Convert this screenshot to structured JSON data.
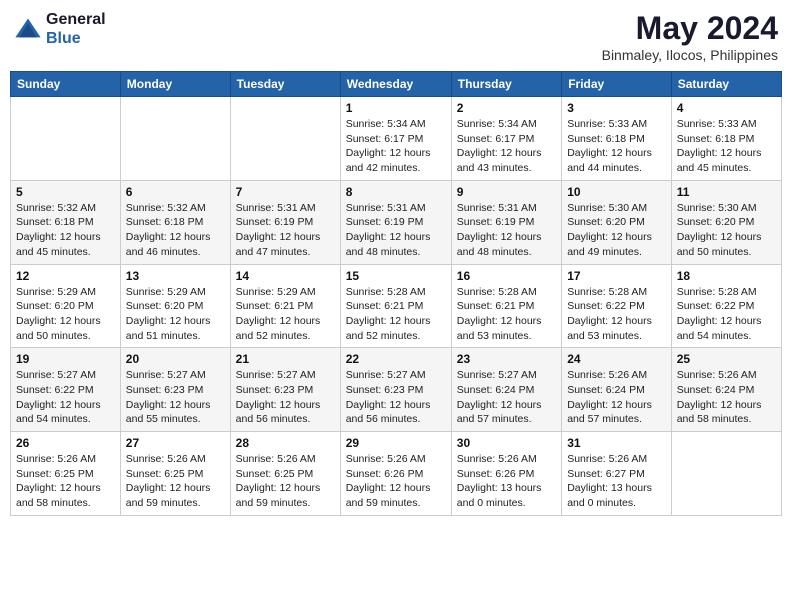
{
  "header": {
    "logo_line1": "General",
    "logo_line2": "Blue",
    "month_year": "May 2024",
    "location": "Binmaley, Ilocos, Philippines"
  },
  "weekdays": [
    "Sunday",
    "Monday",
    "Tuesday",
    "Wednesday",
    "Thursday",
    "Friday",
    "Saturday"
  ],
  "weeks": [
    [
      {
        "day": "",
        "info": ""
      },
      {
        "day": "",
        "info": ""
      },
      {
        "day": "",
        "info": ""
      },
      {
        "day": "1",
        "info": "Sunrise: 5:34 AM\nSunset: 6:17 PM\nDaylight: 12 hours\nand 42 minutes."
      },
      {
        "day": "2",
        "info": "Sunrise: 5:34 AM\nSunset: 6:17 PM\nDaylight: 12 hours\nand 43 minutes."
      },
      {
        "day": "3",
        "info": "Sunrise: 5:33 AM\nSunset: 6:18 PM\nDaylight: 12 hours\nand 44 minutes."
      },
      {
        "day": "4",
        "info": "Sunrise: 5:33 AM\nSunset: 6:18 PM\nDaylight: 12 hours\nand 45 minutes."
      }
    ],
    [
      {
        "day": "5",
        "info": "Sunrise: 5:32 AM\nSunset: 6:18 PM\nDaylight: 12 hours\nand 45 minutes."
      },
      {
        "day": "6",
        "info": "Sunrise: 5:32 AM\nSunset: 6:18 PM\nDaylight: 12 hours\nand 46 minutes."
      },
      {
        "day": "7",
        "info": "Sunrise: 5:31 AM\nSunset: 6:19 PM\nDaylight: 12 hours\nand 47 minutes."
      },
      {
        "day": "8",
        "info": "Sunrise: 5:31 AM\nSunset: 6:19 PM\nDaylight: 12 hours\nand 48 minutes."
      },
      {
        "day": "9",
        "info": "Sunrise: 5:31 AM\nSunset: 6:19 PM\nDaylight: 12 hours\nand 48 minutes."
      },
      {
        "day": "10",
        "info": "Sunrise: 5:30 AM\nSunset: 6:20 PM\nDaylight: 12 hours\nand 49 minutes."
      },
      {
        "day": "11",
        "info": "Sunrise: 5:30 AM\nSunset: 6:20 PM\nDaylight: 12 hours\nand 50 minutes."
      }
    ],
    [
      {
        "day": "12",
        "info": "Sunrise: 5:29 AM\nSunset: 6:20 PM\nDaylight: 12 hours\nand 50 minutes."
      },
      {
        "day": "13",
        "info": "Sunrise: 5:29 AM\nSunset: 6:20 PM\nDaylight: 12 hours\nand 51 minutes."
      },
      {
        "day": "14",
        "info": "Sunrise: 5:29 AM\nSunset: 6:21 PM\nDaylight: 12 hours\nand 52 minutes."
      },
      {
        "day": "15",
        "info": "Sunrise: 5:28 AM\nSunset: 6:21 PM\nDaylight: 12 hours\nand 52 minutes."
      },
      {
        "day": "16",
        "info": "Sunrise: 5:28 AM\nSunset: 6:21 PM\nDaylight: 12 hours\nand 53 minutes."
      },
      {
        "day": "17",
        "info": "Sunrise: 5:28 AM\nSunset: 6:22 PM\nDaylight: 12 hours\nand 53 minutes."
      },
      {
        "day": "18",
        "info": "Sunrise: 5:28 AM\nSunset: 6:22 PM\nDaylight: 12 hours\nand 54 minutes."
      }
    ],
    [
      {
        "day": "19",
        "info": "Sunrise: 5:27 AM\nSunset: 6:22 PM\nDaylight: 12 hours\nand 54 minutes."
      },
      {
        "day": "20",
        "info": "Sunrise: 5:27 AM\nSunset: 6:23 PM\nDaylight: 12 hours\nand 55 minutes."
      },
      {
        "day": "21",
        "info": "Sunrise: 5:27 AM\nSunset: 6:23 PM\nDaylight: 12 hours\nand 56 minutes."
      },
      {
        "day": "22",
        "info": "Sunrise: 5:27 AM\nSunset: 6:23 PM\nDaylight: 12 hours\nand 56 minutes."
      },
      {
        "day": "23",
        "info": "Sunrise: 5:27 AM\nSunset: 6:24 PM\nDaylight: 12 hours\nand 57 minutes."
      },
      {
        "day": "24",
        "info": "Sunrise: 5:26 AM\nSunset: 6:24 PM\nDaylight: 12 hours\nand 57 minutes."
      },
      {
        "day": "25",
        "info": "Sunrise: 5:26 AM\nSunset: 6:24 PM\nDaylight: 12 hours\nand 58 minutes."
      }
    ],
    [
      {
        "day": "26",
        "info": "Sunrise: 5:26 AM\nSunset: 6:25 PM\nDaylight: 12 hours\nand 58 minutes."
      },
      {
        "day": "27",
        "info": "Sunrise: 5:26 AM\nSunset: 6:25 PM\nDaylight: 12 hours\nand 59 minutes."
      },
      {
        "day": "28",
        "info": "Sunrise: 5:26 AM\nSunset: 6:25 PM\nDaylight: 12 hours\nand 59 minutes."
      },
      {
        "day": "29",
        "info": "Sunrise: 5:26 AM\nSunset: 6:26 PM\nDaylight: 12 hours\nand 59 minutes."
      },
      {
        "day": "30",
        "info": "Sunrise: 5:26 AM\nSunset: 6:26 PM\nDaylight: 13 hours\nand 0 minutes."
      },
      {
        "day": "31",
        "info": "Sunrise: 5:26 AM\nSunset: 6:27 PM\nDaylight: 13 hours\nand 0 minutes."
      },
      {
        "day": "",
        "info": ""
      }
    ]
  ]
}
